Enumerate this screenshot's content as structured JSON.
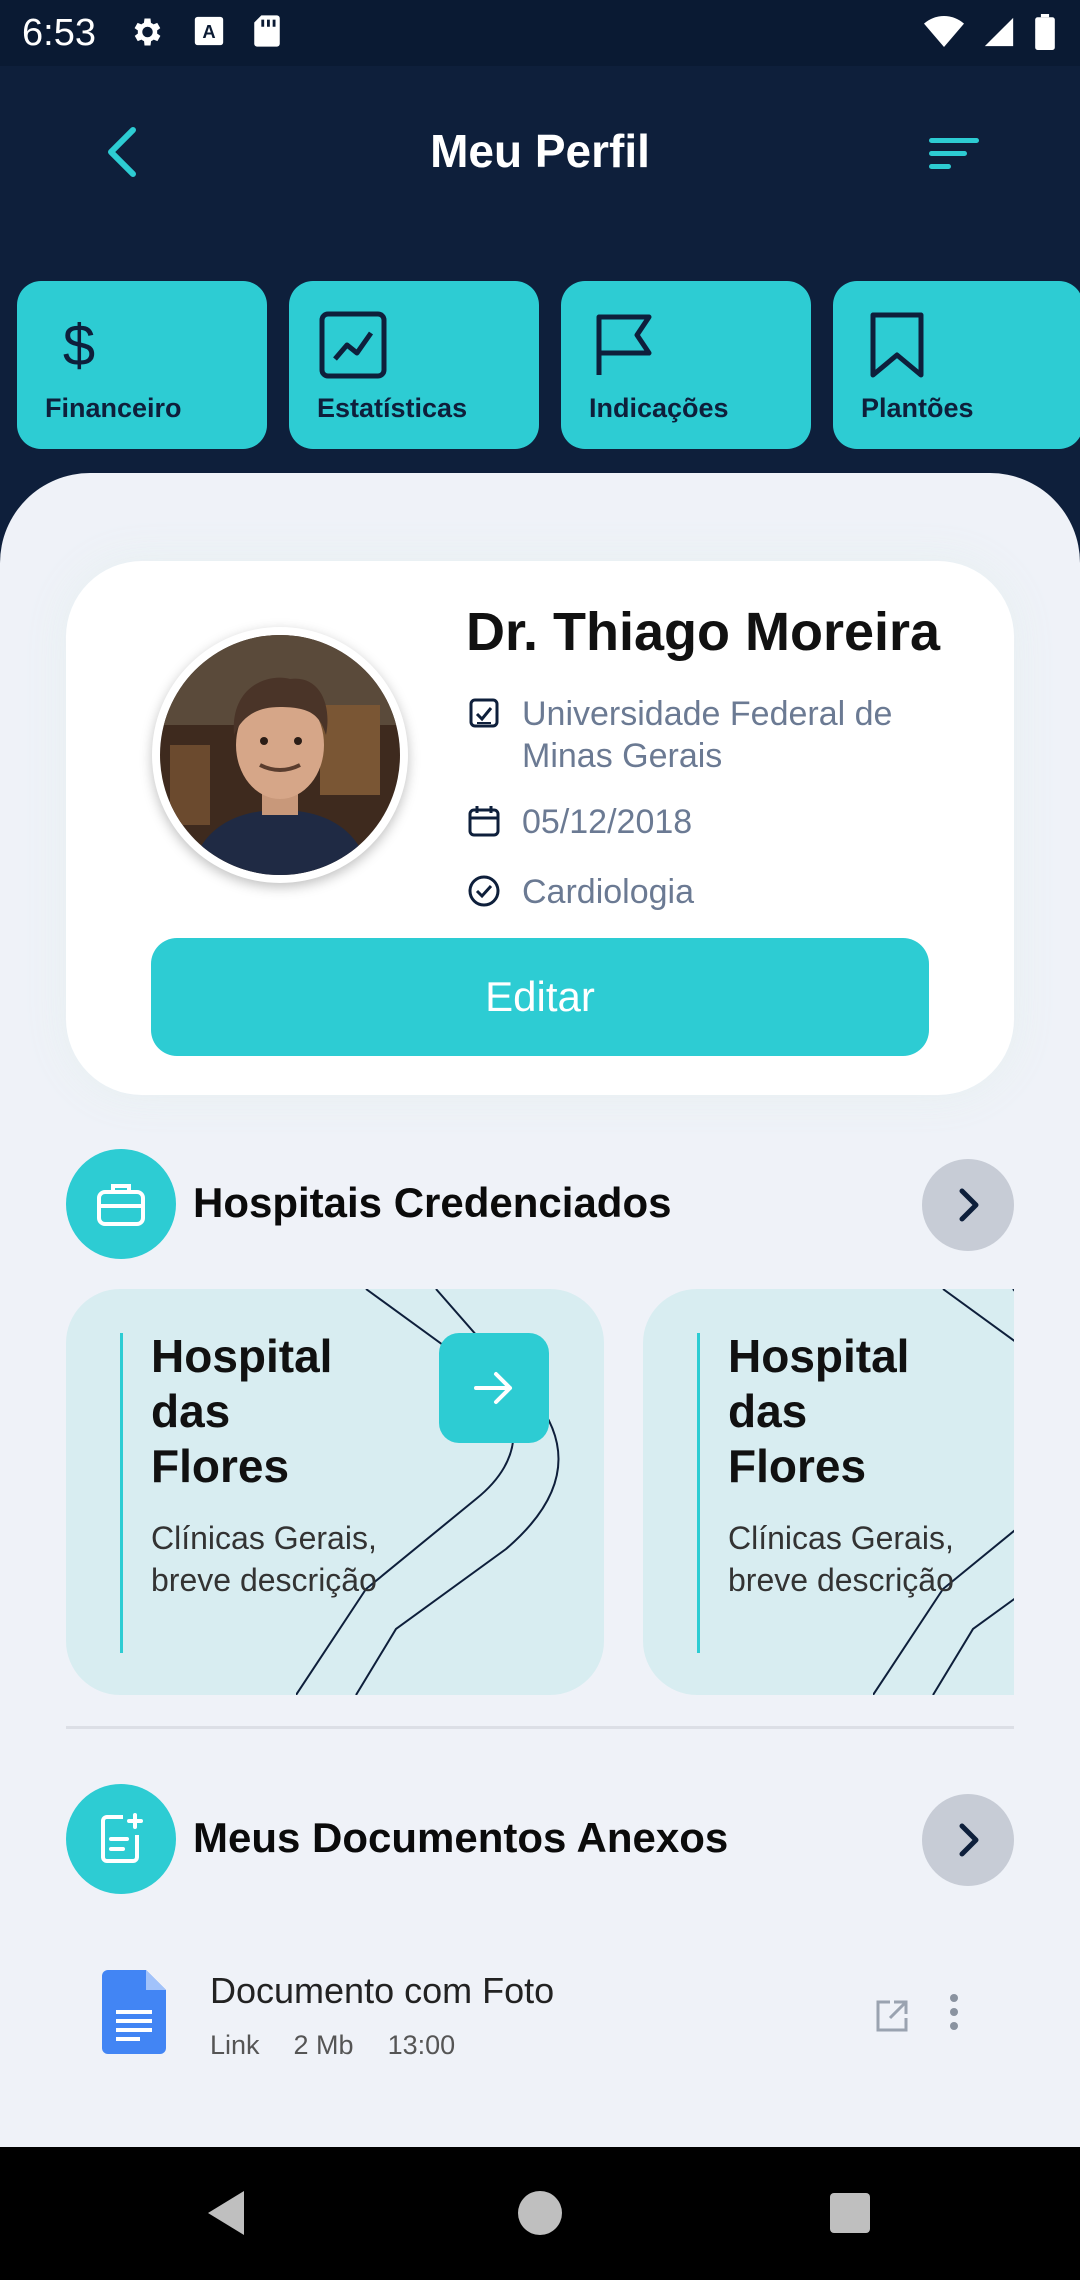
{
  "status_bar": {
    "time": "6:53",
    "icons": [
      "gear-icon",
      "font-icon",
      "sd-card-icon",
      "wifi-icon",
      "signal-icon",
      "battery-icon"
    ]
  },
  "header": {
    "title": "Meu Perfil"
  },
  "tabs": [
    {
      "label": "Financeiro",
      "icon": "dollar-icon"
    },
    {
      "label": "Estatísticas",
      "icon": "chart-icon"
    },
    {
      "label": "Indicações",
      "icon": "flag-icon"
    },
    {
      "label": "Plantões",
      "icon": "bookmark-icon"
    }
  ],
  "profile": {
    "name": "Dr. Thiago Moreira",
    "university": "Universidade Federal de Minas Gerais",
    "date": "05/12/2018",
    "specialty": "Cardiologia",
    "edit_label": "Editar"
  },
  "hospitals": {
    "title": "Hospitais Credenciados",
    "items": [
      {
        "name": "Hospital das Flores",
        "description": "Clínicas Gerais, breve descrição"
      },
      {
        "name": "Hospital das Flores",
        "description": "Clínicas Gerais, breve descrição"
      }
    ]
  },
  "documents": {
    "title": "Meus Documentos Anexos",
    "items": [
      {
        "name": "Documento com Foto",
        "type": "Link",
        "size": "2 Mb",
        "time": "13:00"
      }
    ]
  },
  "colors": {
    "accent": "#2dccd3",
    "header_bg": "#0e1f3b",
    "sheet_bg": "#eff2f8"
  }
}
